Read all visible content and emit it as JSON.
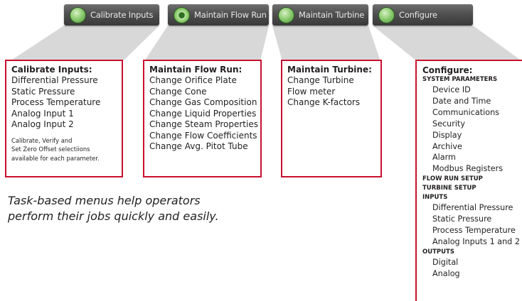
{
  "tabs": [
    {
      "id": "calibrate",
      "label": "Calibrate Inputs",
      "icon": "gauge-icon"
    },
    {
      "id": "flowrun",
      "label": "Maintain Flow Run",
      "icon": "ring-icon"
    },
    {
      "id": "turbine",
      "label": "Maintain Turbine",
      "icon": "turbine-icon"
    },
    {
      "id": "configure",
      "label": "Configure",
      "icon": "wrench-icon"
    }
  ],
  "panels": {
    "calibrate": {
      "title": "Calibrate Inputs:",
      "items": [
        "Differential Pressure",
        "Static Pressure",
        "Process Temperature",
        "Analog Input 1",
        "Analog Input 2"
      ],
      "note": [
        "Calibrate, Verify and",
        "Set Zero Offset selectiions",
        "available for each parameter."
      ]
    },
    "flowrun": {
      "title": "Maintain Flow Run:",
      "items": [
        "Change Orifice Plate",
        "Change Cone",
        "Change Gas Composition",
        "Change Liquid Properties",
        "Change Steam Properties",
        "Change Flow Coefficients",
        "Change Avg. Pitot Tube"
      ]
    },
    "turbine": {
      "title": "Maintain Turbine:",
      "items": [
        "Change Turbine",
        "Flow meter",
        "Change K-factors"
      ]
    },
    "configure": {
      "title": "Configure:",
      "sections": [
        {
          "name": "SYSTEM PARAMETERS",
          "items": [
            "Device ID",
            "Date and Time",
            "Communications",
            "Security",
            "Display",
            "Archive",
            "Alarm",
            "Modbus Registers"
          ]
        },
        {
          "name": "FLOW RUN SETUP",
          "items": []
        },
        {
          "name": "TURBINE SETUP",
          "items": []
        },
        {
          "name": "INPUTS",
          "items": [
            "Differential Pressure",
            "Static Pressure",
            "Process Temperature",
            "Analog Inputs 1 and 2"
          ]
        },
        {
          "name": "OUTPUTS",
          "items": [
            "Digital",
            "Analog"
          ]
        }
      ]
    }
  },
  "tagline": [
    "Task-based menus help operators",
    "perform their jobs quickly and easily."
  ],
  "colors": {
    "accent": "#c8102e",
    "tab_bg": "#4a4a4a",
    "connector": "#d9d9d9"
  }
}
